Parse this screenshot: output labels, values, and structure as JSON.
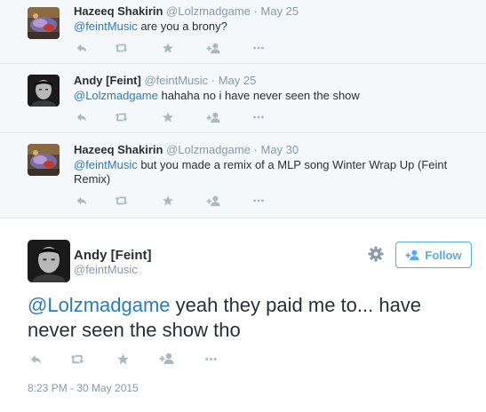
{
  "replies": [
    {
      "name": "Hazeeq Shakirin",
      "handle": "@Lolzmadgame",
      "separator": "·",
      "time": "May 25",
      "mention": "@feintMusic",
      "text": " are you a brony?"
    },
    {
      "name": "Andy [Feint]",
      "handle": "@feintMusic",
      "separator": "·",
      "time": "May 25",
      "mention": "@Lolzmadgame",
      "text": " hahaha no i have never seen the show"
    },
    {
      "name": "Hazeeq Shakirin",
      "handle": "@Lolzmadgame",
      "separator": "·",
      "time": "May 30",
      "mention": "@feintMusic",
      "text": " but you made a remix of a MLP song Winter Wrap Up (Feint Remix)"
    }
  ],
  "main_tweet": {
    "name": "Andy [Feint]",
    "handle": "@feintMusic",
    "follow_label": "Follow",
    "mention": "@Lolzmadgame",
    "text": " yeah they paid me to... have never seen the show tho",
    "timestamp": "8:23 PM - 30 May 2015"
  },
  "action_icons": [
    "reply-icon",
    "retweet-icon",
    "favorite-icon",
    "follow-icon",
    "more-icon"
  ],
  "colors": {
    "link": "#2b7bb9",
    "accent": "#55acee",
    "muted": "#8899a6",
    "icon": "#aab8c2",
    "thread_bg": "#f5f8fa"
  }
}
